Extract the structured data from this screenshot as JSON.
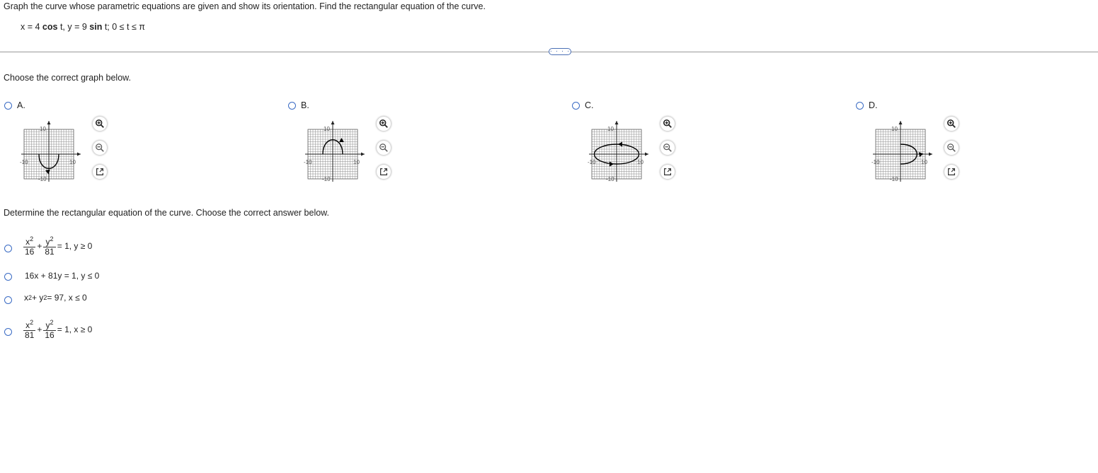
{
  "question": {
    "instruction": "Graph the curve whose parametric equations are given and show its orientation. Find the rectangular equation of the curve.",
    "eq_x_lhs": "x = 4 ",
    "eq_x_fn": "cos",
    "eq_x_tail": " t,  y = 9 ",
    "eq_y_fn": "sin",
    "eq_y_tail": " t;  0 ≤ t ≤ π"
  },
  "divider": {
    "more_label": "· · · ·"
  },
  "part1": {
    "prompt": "Choose the correct graph below.",
    "options": [
      {
        "letter": "A.",
        "tick_top": "10",
        "tick_bottom": "-10",
        "tick_left": "-10",
        "tick_right": "10"
      },
      {
        "letter": "B.",
        "tick_top": "10",
        "tick_bottom": "-10",
        "tick_left": "-10",
        "tick_right": "10"
      },
      {
        "letter": "C.",
        "tick_top": "10",
        "tick_bottom": "-10",
        "tick_left": "-10",
        "tick_right": "10"
      },
      {
        "letter": "D.",
        "tick_top": "10",
        "tick_bottom": "-10",
        "tick_left": "-10",
        "tick_right": "10"
      }
    ],
    "tools": [
      "zoom-in-icon",
      "zoom-out-icon",
      "popout-icon"
    ]
  },
  "part2": {
    "prompt": "Determine the rectangular equation of the curve. Choose the correct answer below.",
    "answers": [
      {
        "num1": "x",
        "exp1": "2",
        "den1": "16",
        "op": "+",
        "num2": "y",
        "exp2": "2",
        "den2": "81",
        "tail": "= 1,  y ≥ 0"
      },
      {
        "text": "16x + 81y = 1,  y ≤ 0"
      },
      {
        "base1": "x",
        "exp1": "2",
        "mid": " + y",
        "exp2": "2",
        "tail": " = 97,  x ≤ 0"
      },
      {
        "num1": "x",
        "exp1": "2",
        "den1": "81",
        "op": "+",
        "num2": "y",
        "exp2": "2",
        "den2": "16",
        "tail": "= 1,  x ≥ 0"
      }
    ]
  },
  "colors": {
    "radio": "#3a6bc4",
    "grid": "#8a8a8a",
    "curve": "#000000"
  }
}
